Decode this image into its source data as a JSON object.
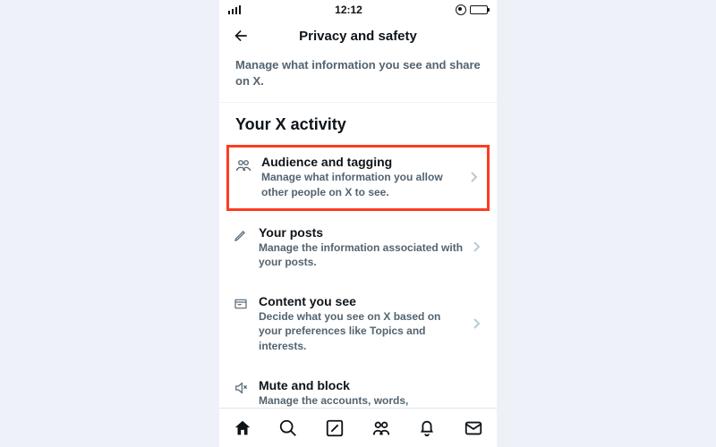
{
  "status": {
    "time": "12:12"
  },
  "header": {
    "title": "Privacy and safety",
    "subtitle": "Manage what information you see and share on X."
  },
  "section": {
    "title": "Your X activity"
  },
  "rows": [
    {
      "title": "Audience and tagging",
      "desc": "Manage what information you allow other people on X to see."
    },
    {
      "title": "Your posts",
      "desc": "Manage the information associated with your posts."
    },
    {
      "title": "Content you see",
      "desc": "Decide what you see on X based on your preferences like Topics and interests."
    },
    {
      "title": "Mute and block",
      "desc": "Manage the accounts, words,"
    }
  ]
}
